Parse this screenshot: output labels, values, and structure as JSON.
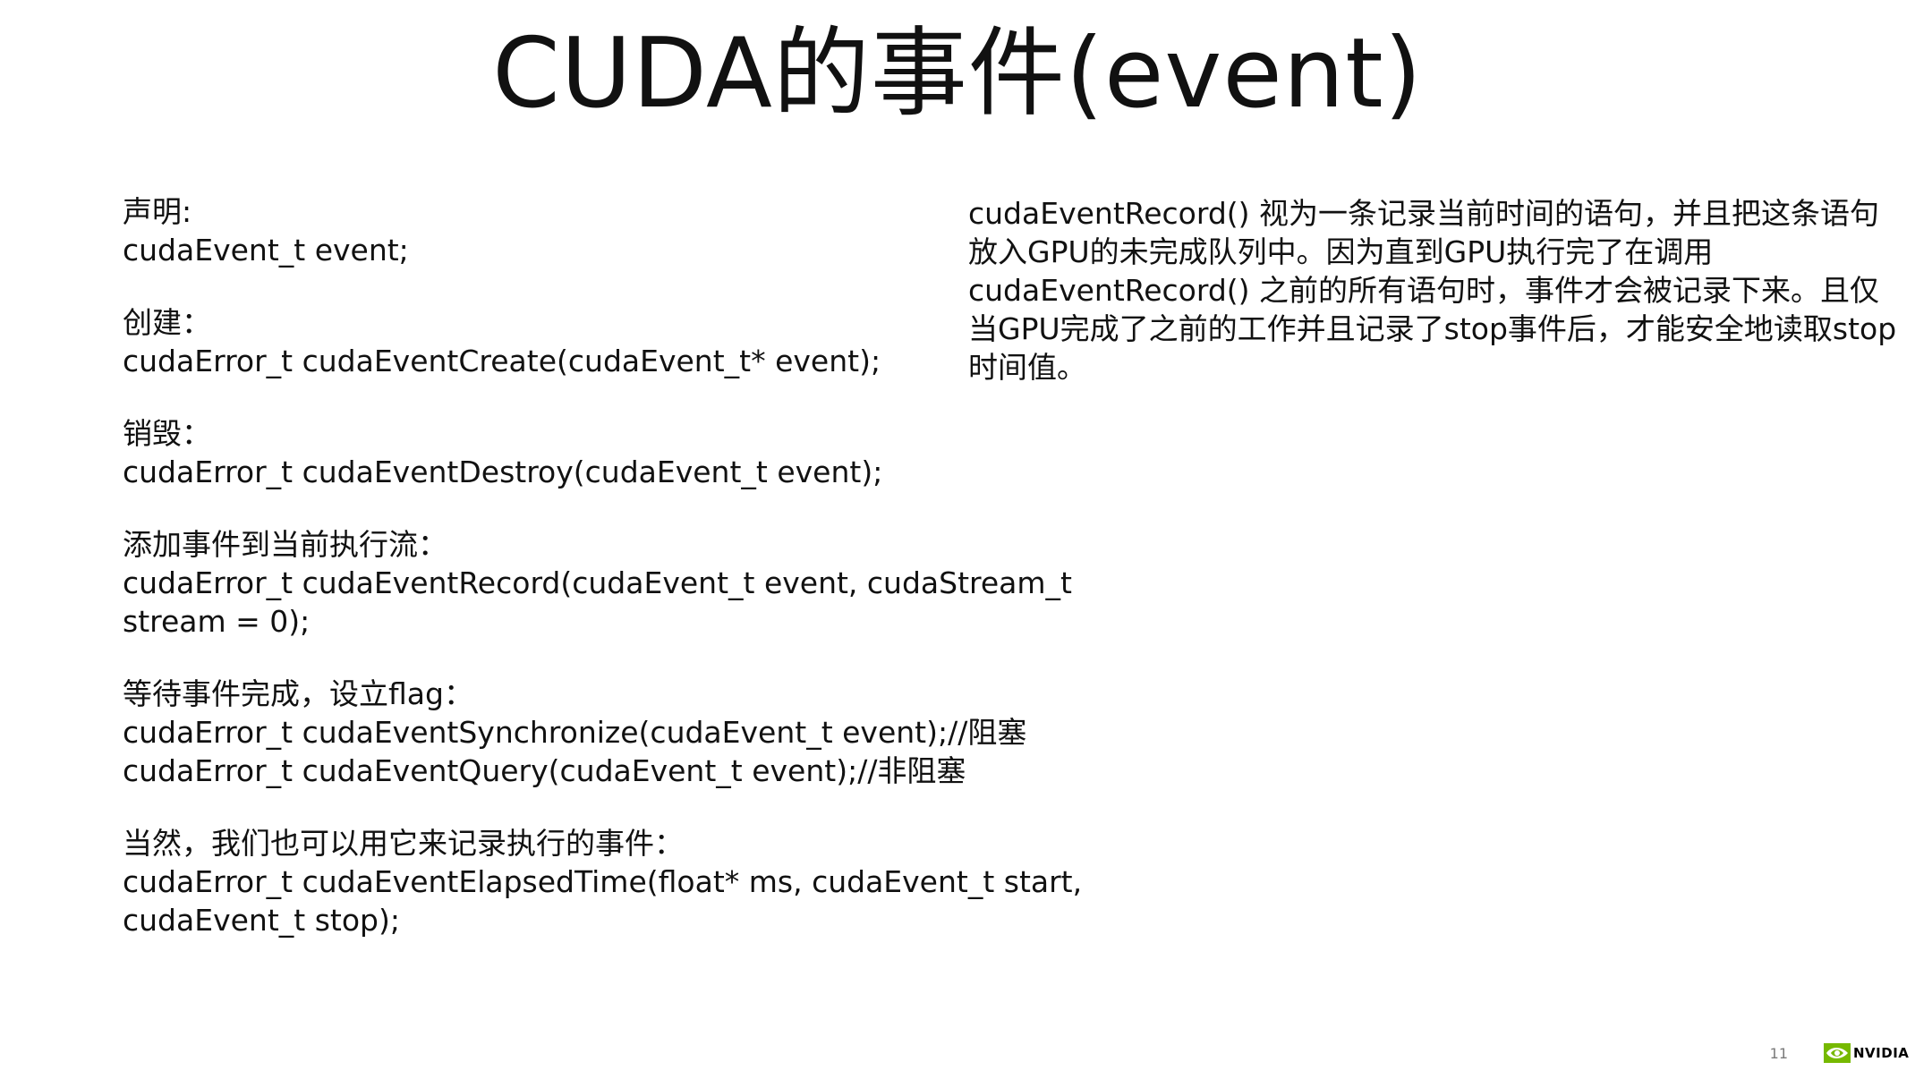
{
  "title": "CUDA的事件(event)",
  "left_blocks": [
    {
      "heading": "声明:",
      "lines": [
        "cudaEvent_t event;"
      ]
    },
    {
      "heading": "创建：",
      "lines": [
        "cudaError_t cudaEventCreate(cudaEvent_t* event);"
      ]
    },
    {
      "heading": "销毁：",
      "lines": [
        "cudaError_t cudaEventDestroy(cudaEvent_t event);"
      ]
    },
    {
      "heading": "添加事件到当前执行流：",
      "lines": [
        "cudaError_t cudaEventRecord(cudaEvent_t event, cudaStream_t",
        "stream = 0);"
      ]
    },
    {
      "heading": "等待事件完成，设立flag：",
      "lines": [
        "cudaError_t cudaEventSynchronize(cudaEvent_t event);//阻塞",
        "cudaError_t cudaEventQuery(cudaEvent_t event);//非阻塞"
      ]
    },
    {
      "heading": "当然，我们也可以用它来记录执行的事件：",
      "lines": [
        "cudaError_t cudaEventElapsedTime(float* ms, cudaEvent_t start,",
        "cudaEvent_t stop);"
      ]
    }
  ],
  "right_text": "cudaEventRecord() 视为一条记录当前时间的语句，并且把这条语句放入GPU的未完成队列中。因为直到GPU执行完了在调用cudaEventRecord() 之前的所有语句时，事件才会被记录下来。且仅当GPU完成了之前的工作并且记录了stop事件后，才能安全地读取stop时间值。",
  "footer": {
    "page_number": "11",
    "logo_text": "NVIDIA",
    "logo_icon": "nvidia-eye-icon",
    "logo_color": "#76b900"
  }
}
